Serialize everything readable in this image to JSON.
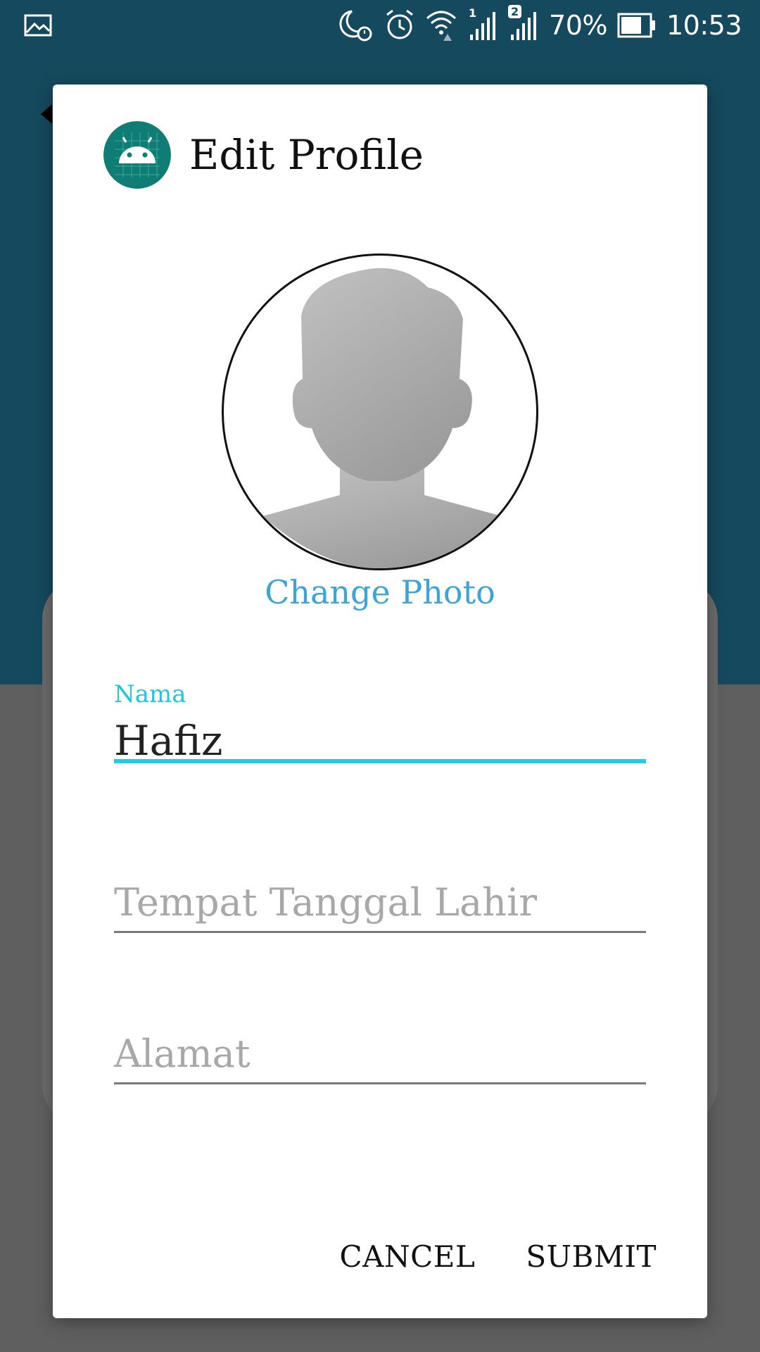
{
  "status_bar": {
    "battery_percent": "70%",
    "time": "10:53",
    "sim1_label": "1",
    "sim2_label": "2",
    "icons": [
      "gallery-icon",
      "moon-alarm-icon",
      "alarm-icon",
      "wifi-icon",
      "signal-sim1-icon",
      "signal-sim2-icon",
      "battery-icon"
    ]
  },
  "dialog": {
    "title": "Edit Profile",
    "change_photo_label": "Change Photo",
    "fields": {
      "nama": {
        "label": "Nama",
        "value": "Hafiz"
      },
      "ttl": {
        "placeholder": "Tempat Tanggal Lahir"
      },
      "alamat": {
        "placeholder": "Alamat"
      }
    },
    "buttons": {
      "cancel": "CANCEL",
      "submit": "SUBMIT"
    }
  },
  "colors": {
    "accent": "#1fcde6",
    "link": "#3aa5d6",
    "app_bar": "#15495d",
    "app_icon": "#0f7d73"
  }
}
